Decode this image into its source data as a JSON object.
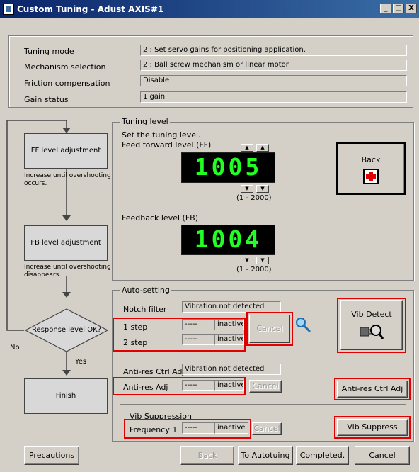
{
  "window": {
    "title": "Custom Tuning - Adust AXIS#1",
    "controls": [
      "_",
      "□",
      "X"
    ]
  },
  "settings": {
    "rows": [
      {
        "label": "Tuning mode",
        "value": "2 : Set servo gains for positioning application."
      },
      {
        "label": "Mechanism selection",
        "value": "2 : Ball screw mechanism or linear motor"
      },
      {
        "label": "Friction compensation",
        "value": "Disable"
      },
      {
        "label": "Gain status",
        "value": "1 gain"
      }
    ]
  },
  "flow": {
    "ff_box": "FF level adjustment",
    "ff_note": "Increase until overshooting occurs.",
    "fb_box": "FB level adjustment",
    "fb_note": "Increase until overshooting disappears.",
    "decision": "Response level OK?",
    "no_label": "No",
    "yes_label": "Yes",
    "finish": "Finish"
  },
  "tuning_level": {
    "title": "Tuning level",
    "instruction": "Set the tuning level.",
    "ff_label": "Feed forward level (FF)",
    "ff_value": "1005",
    "ff_range": "(1 - 2000)",
    "fb_label": "Feedback level (FB)",
    "fb_value": "1004",
    "fb_range": "(1 - 2000)",
    "back_button": "Back"
  },
  "auto_setting": {
    "title": "Auto-setting",
    "notch_label": "Notch filter",
    "notch_status": "Vibration not detected",
    "steps": [
      {
        "label": "1 step",
        "value": "-----",
        "state": "inactive"
      },
      {
        "label": "2 step",
        "value": "-----",
        "state": "inactive"
      }
    ],
    "cancel": "Cancel",
    "vib_detect": "Vib Detect",
    "antires_ctrl_label": "Anti-res Ctrl Adj",
    "antires_status": "Vibration not detected",
    "antires_adj": {
      "label": "Anti-res Adj",
      "value": "-----",
      "state": "inactive"
    },
    "antires_cancel": "Cancel",
    "antires_button": "Anti-res Ctrl Adj",
    "vib_suppression_title": "Vib Suppression",
    "frequency": {
      "label": "Frequency 1",
      "value": "-----",
      "state": "inactive"
    },
    "vib_cancel": "Cancel",
    "vib_suppress_button": "Vib Suppress"
  },
  "footer": {
    "precautions": "Precautions",
    "back": "Back",
    "to_autotuning": "To Autotuing",
    "completed": "Completed.",
    "cancel": "Cancel"
  }
}
